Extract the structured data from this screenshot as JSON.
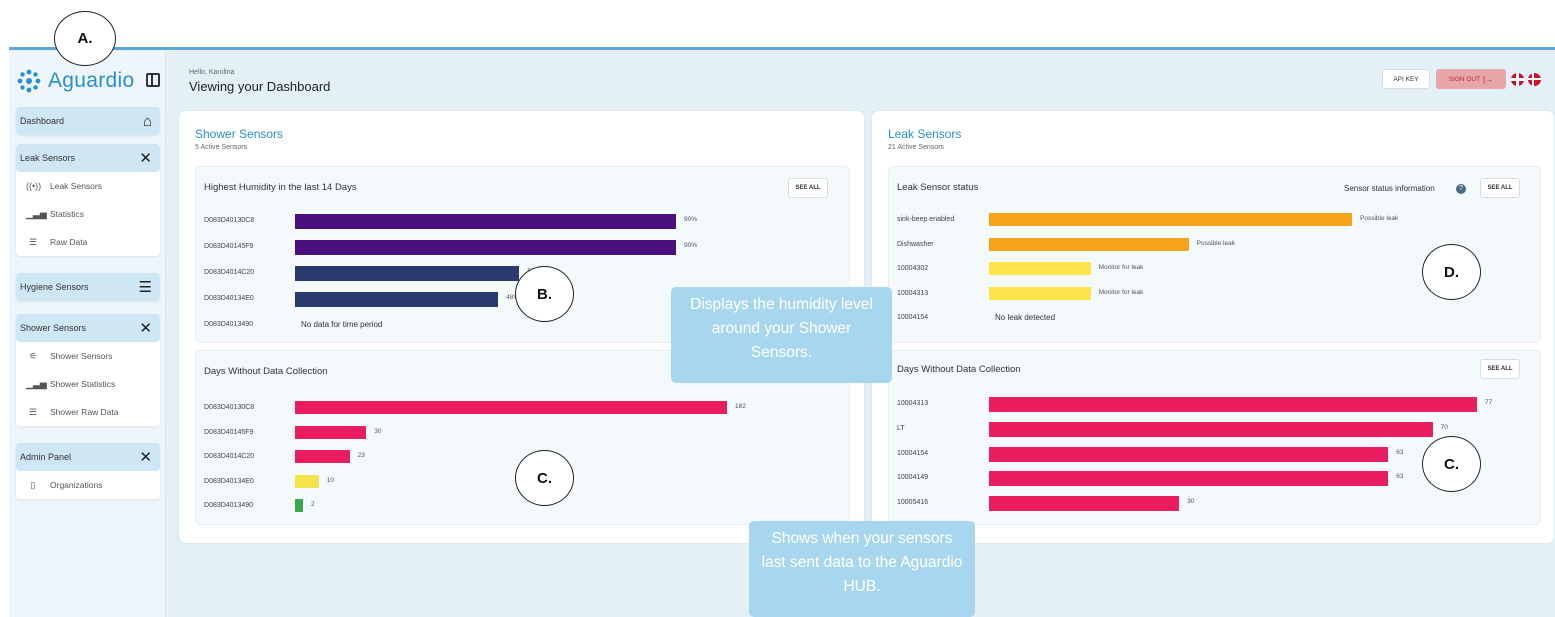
{
  "app": {
    "brand": "Aguardio",
    "greeting": "Hello, Karolina",
    "title": "Viewing your Dashboard",
    "api_key_label": "API KEY",
    "sign_out_label": "SIGN OUT"
  },
  "sidebar": {
    "dashboard": "Dashboard",
    "leak_group": "Leak Sensors",
    "leak_items": [
      "Leak Sensors",
      "Statistics",
      "Raw Data"
    ],
    "hygiene_group": "Hygiene Sensors",
    "shower_group": "Shower Sensors",
    "shower_items": [
      "Shower Sensors",
      "Shower Statistics",
      "Shower Raw Data"
    ],
    "admin_group": "Admin Panel",
    "admin_items": [
      "Organizations"
    ]
  },
  "shower": {
    "title": "Shower Sensors",
    "subtitle": "5 Active Sensors",
    "humidity": {
      "title": "Highest Humidity in the last 14 Days",
      "see_all": "SEE ALL",
      "rows": [
        {
          "label": "D083D40130C8",
          "value": 90,
          "display": "90%",
          "color": "#4b0f7e"
        },
        {
          "label": "D083D40145F9",
          "value": 90,
          "display": "90%",
          "color": "#4b0f7e"
        },
        {
          "label": "D083D4014C20",
          "value": 53,
          "display": "53%",
          "color": "#2b3a6e"
        },
        {
          "label": "D083D40134E0",
          "value": 48,
          "display": "48%",
          "color": "#2b3a6e"
        },
        {
          "label": "D083D4013490",
          "value": null,
          "display": "No data for time period",
          "color": ""
        }
      ]
    },
    "nodata": {
      "title": "Days Without Data Collection",
      "rows": [
        {
          "label": "D083D40130C8",
          "value": 182,
          "display": "182",
          "color": "#ea1e5e"
        },
        {
          "label": "D083D40145F9",
          "value": 30,
          "display": "30",
          "color": "#ea1e5e"
        },
        {
          "label": "D083D4014C20",
          "value": 23,
          "display": "23",
          "color": "#ea1e5e"
        },
        {
          "label": "D083D40134E0",
          "value": 10,
          "display": "10",
          "color": "#f5e34a"
        },
        {
          "label": "D083D4013490",
          "value": 2,
          "display": "2",
          "color": "#3aa84a"
        }
      ]
    }
  },
  "leak": {
    "title": "Leak Sensors",
    "subtitle": "21 Active Sensors",
    "status": {
      "title": "Leak Sensor status",
      "info": "Sensor status information",
      "see_all": "SEE ALL",
      "rows": [
        {
          "label": "sink-beep enabled",
          "value": 100,
          "display": "Possible leak",
          "color": "#f7a21b"
        },
        {
          "label": "Dishwasher",
          "value": 55,
          "display": "Possible leak",
          "color": "#f7a21b"
        },
        {
          "label": "10004302",
          "value": 28,
          "display": "Monitor for leak",
          "color": "#fbe54a"
        },
        {
          "label": "10004313",
          "value": 28,
          "display": "Monitor for leak",
          "color": "#fbe54a"
        },
        {
          "label": "10004154",
          "value": null,
          "display": "No leak detected",
          "color": ""
        }
      ]
    },
    "nodata": {
      "title": "Days Without Data Collection",
      "see_all": "SEE ALL",
      "rows": [
        {
          "label": "10004313",
          "value": 77,
          "display": "77",
          "color": "#ea1e5e"
        },
        {
          "label": "LT",
          "value": 70,
          "display": "70",
          "color": "#ea1e5e"
        },
        {
          "label": "10004154",
          "value": 63,
          "display": "63",
          "color": "#ea1e5e"
        },
        {
          "label": "10004149",
          "value": 63,
          "display": "63",
          "color": "#ea1e5e"
        },
        {
          "label": "10005416",
          "value": 30,
          "display": "30",
          "color": "#ea1e5e"
        }
      ]
    }
  },
  "annotations": {
    "a": "A.",
    "b": "B.",
    "c1": "C.",
    "c2": "C.",
    "d": "D.",
    "tip_humidity": "Displays the humidity level around your Shower Sensors.",
    "tip_nodata": "Shows when your sensors last sent data to the Aguardio HUB."
  }
}
